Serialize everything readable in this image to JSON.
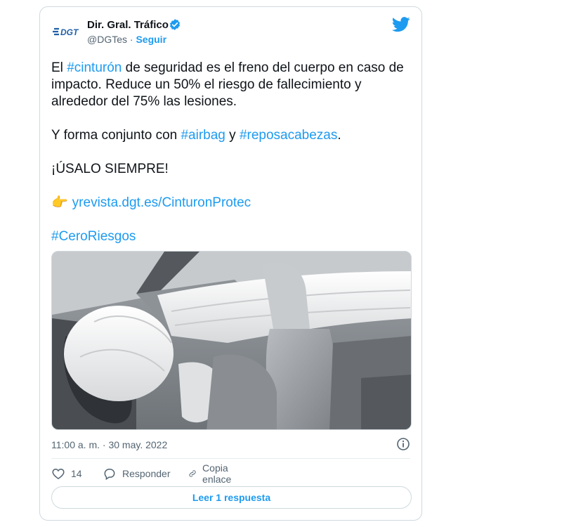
{
  "author": {
    "name": "Dir. Gral. Tráfico",
    "handle": "@DGTes",
    "separator": "·",
    "follow_label": "Seguir",
    "logo_text": "DGT"
  },
  "tweet": {
    "line1_pre": "El ",
    "line1_tag": "#cinturón",
    "line1_post": " de seguridad es el freno del cuerpo en caso de impacto. Reduce un 50% el riesgo de fallecimiento y alrededor del 75% las lesiones.",
    "line2_pre": "Y forma conjunto con ",
    "line2_tag1": "#airbag",
    "line2_mid": " y ",
    "line2_tag2": "#reposacabezas",
    "line2_post": ".",
    "line3": "¡ÚSALO SIEMPRE!",
    "link_emoji": "👉",
    "link": "yrevista.dgt.es/CinturonProtec",
    "hashtag_final": "#CeroRiesgos"
  },
  "meta": {
    "timestamp": "11:00 a. m. · 30 may. 2022"
  },
  "actions": {
    "like_count": "14",
    "reply_label": "Responder",
    "copy_label": "Copia enlace"
  },
  "read_replies_label": "Leer 1 respuesta",
  "colors": {
    "accent": "#1d9bf0",
    "text": "#0f1419",
    "muted": "#536471",
    "border": "#cfd9de"
  }
}
